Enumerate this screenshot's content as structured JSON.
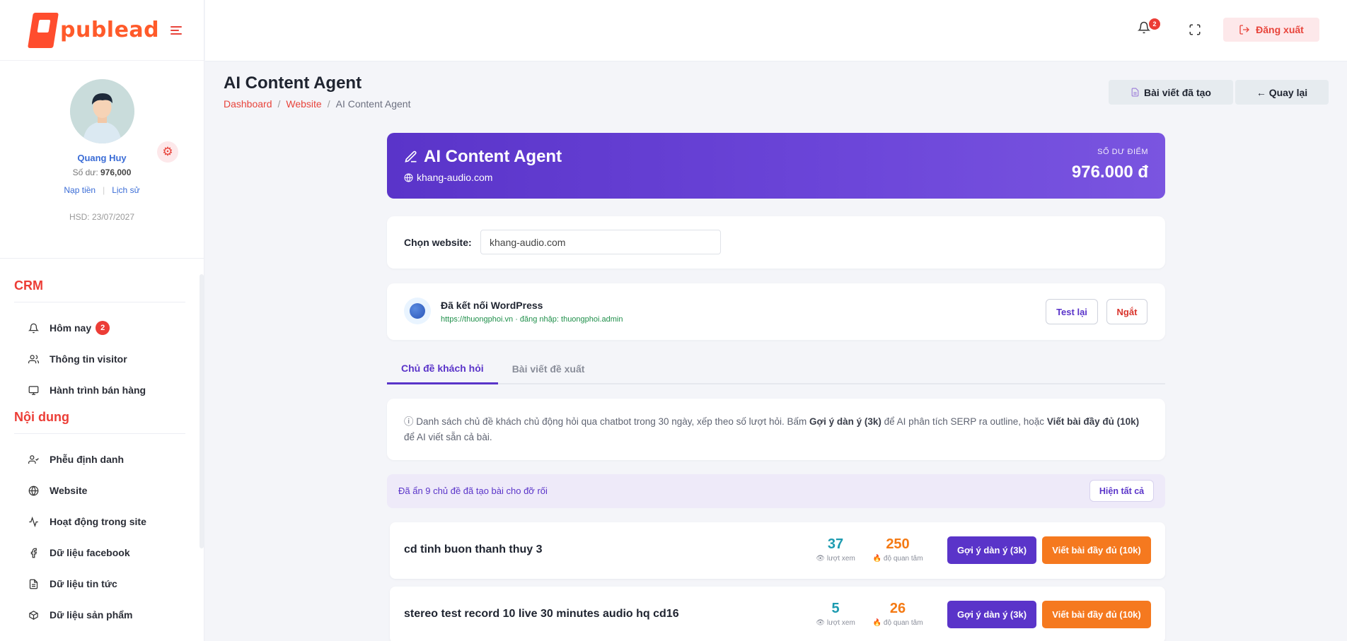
{
  "brand": {
    "name": "publead"
  },
  "profile": {
    "name": "Quang Huy",
    "balance_label": "Số dư:",
    "balance_value": "976,000",
    "topup_link": "Nạp tiền",
    "history_link": "Lịch sử",
    "expiry": "HSD: 23/07/2027"
  },
  "sidebar": {
    "sections": [
      {
        "title": "CRM",
        "items": [
          {
            "label": "Hôm nay",
            "icon": "bell-icon",
            "badge": "2"
          },
          {
            "label": "Thông tin visitor",
            "icon": "users-icon"
          },
          {
            "label": "Hành trình bán hàng",
            "icon": "monitor-icon"
          }
        ]
      },
      {
        "title": "Nội dung",
        "items": [
          {
            "label": "Phễu định danh",
            "icon": "user-check-icon"
          },
          {
            "label": "Website",
            "icon": "globe-icon"
          },
          {
            "label": "Hoạt động trong site",
            "icon": "activity-icon"
          },
          {
            "label": "Dữ liệu facebook",
            "icon": "facebook-icon"
          },
          {
            "label": "Dữ liệu tin tức",
            "icon": "file-text-icon"
          },
          {
            "label": "Dữ liệu sản phẩm",
            "icon": "box-icon"
          }
        ]
      }
    ]
  },
  "topbar": {
    "notification_count": "2",
    "logout_label": "Đăng xuất"
  },
  "page": {
    "title": "AI Content Agent",
    "breadcrumb": [
      "Dashboard",
      "Website",
      "AI Content Agent"
    ],
    "created_posts_label": "Bài viết đã tạo",
    "back_label": "← Quay lại"
  },
  "hero": {
    "title": "AI Content Agent",
    "site": "khang-audio.com",
    "balance_label": "SỐ DƯ ĐIỂM",
    "balance_value": "976.000 đ"
  },
  "site_select": {
    "label": "Chọn website:",
    "value": "khang-audio.com"
  },
  "wordpress": {
    "title": "Đã kết nối WordPress",
    "detail": "https://thuongphoi.vn · đăng nhập: thuongphoi.admin",
    "test_label": "Test lại",
    "disconnect_label": "Ngắt"
  },
  "tabs": [
    {
      "label": "Chủ đề khách hỏi",
      "active": true
    },
    {
      "label": "Bài viết đề xuất",
      "active": false
    }
  ],
  "info": {
    "text_1": "ⓘ Danh sách chủ đề khách chủ động hỏi qua chatbot trong 30 ngày, xếp theo số lượt hỏi. Bấm ",
    "bold_1": "Gợi ý dàn ý (3k)",
    "text_2": " để AI phân tích SERP ra outline, hoặc ",
    "bold_2": "Viết bài đầy đủ (10k)",
    "text_3": " để AI viết sẵn cả bài."
  },
  "hidden_notice": {
    "text": "Đã ẩn 9 chủ đề đã tạo bài cho đỡ rối",
    "show_all_label": "Hiện tất cả"
  },
  "topics": [
    {
      "title": "cd tinh buon thanh thuy 3",
      "views": "37",
      "views_label": "lượt xem",
      "interest": "250",
      "interest_label": "độ quan tâm",
      "outline_label": "Gợi ý dàn ý (3k)",
      "full_label": "Viết bài đầy đủ (10k)"
    },
    {
      "title": "stereo test record 10 live 30 minutes audio hq cd16",
      "views": "5",
      "views_label": "lượt xem",
      "interest": "26",
      "interest_label": "độ quan tâm",
      "outline_label": "Gợi ý dàn ý (3k)",
      "full_label": "Viết bài đầy đủ (10k)"
    }
  ],
  "colors": {
    "primary": "#5a34c9",
    "accent_red": "#ec3d36",
    "accent_orange": "#f5791f",
    "views_teal": "#1d9bb0"
  }
}
